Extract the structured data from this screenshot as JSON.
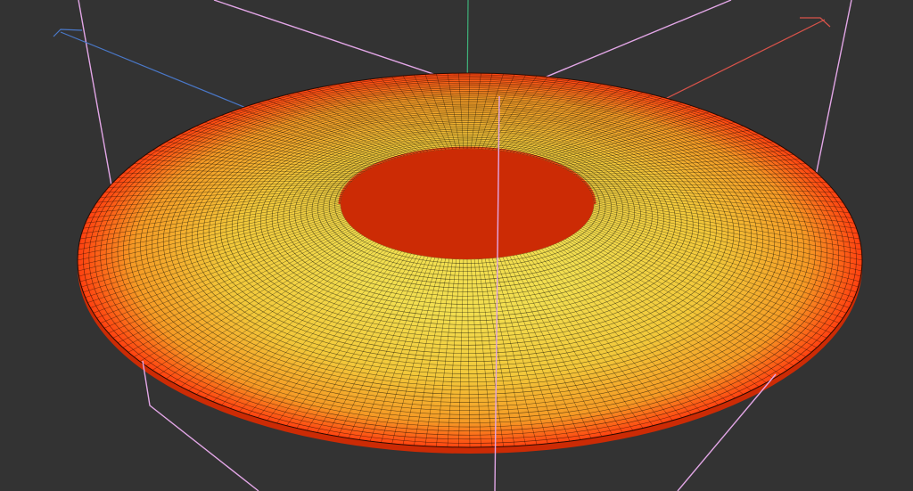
{
  "scene": {
    "background": "#333333",
    "colors": {
      "x_axis": "#d9534a",
      "y_axis": "#3fb27a",
      "z_axis": "#4a78c8",
      "bounding_box": "#e2a6e6",
      "surface_inner": "#f2de4f",
      "surface_mid": "#f5b431",
      "surface_outer": "#ff4010",
      "mesh_line": "#000000"
    },
    "shape": "torus",
    "wireframe": true
  }
}
